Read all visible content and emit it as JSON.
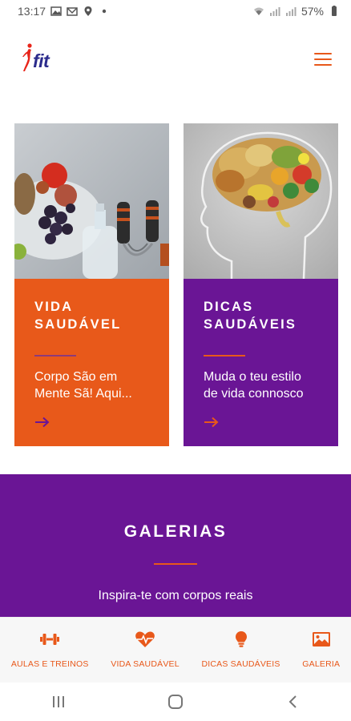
{
  "status_bar": {
    "time": "13:17",
    "battery": "57%"
  },
  "header": {
    "logo_text": "fit"
  },
  "cards": [
    {
      "title": "VIDA\nSAUDÁVEL",
      "text": "Corpo São em Mente Sã! Aqui...",
      "color": "#e8591a"
    },
    {
      "title": "DICAS\nSAUDÁVEIS",
      "text": "Muda o teu estilo de vida connosco",
      "color": "#6a1595"
    }
  ],
  "galerias": {
    "title": "GALERIAS",
    "subtitle": "Inspira-te com corpos reais"
  },
  "bottom_nav": [
    {
      "label": "AULAS E TREINOS",
      "icon": "dumbbell-icon"
    },
    {
      "label": "VIDA SAUDÁVEL",
      "icon": "heartbeat-icon"
    },
    {
      "label": "DICAS SAUDÁVEIS",
      "icon": "lightbulb-icon"
    },
    {
      "label": "GALERIA",
      "icon": "image-icon"
    }
  ],
  "colors": {
    "accent": "#e8581a",
    "purple": "#6a1595",
    "logo_blue": "#2b2b8c"
  }
}
